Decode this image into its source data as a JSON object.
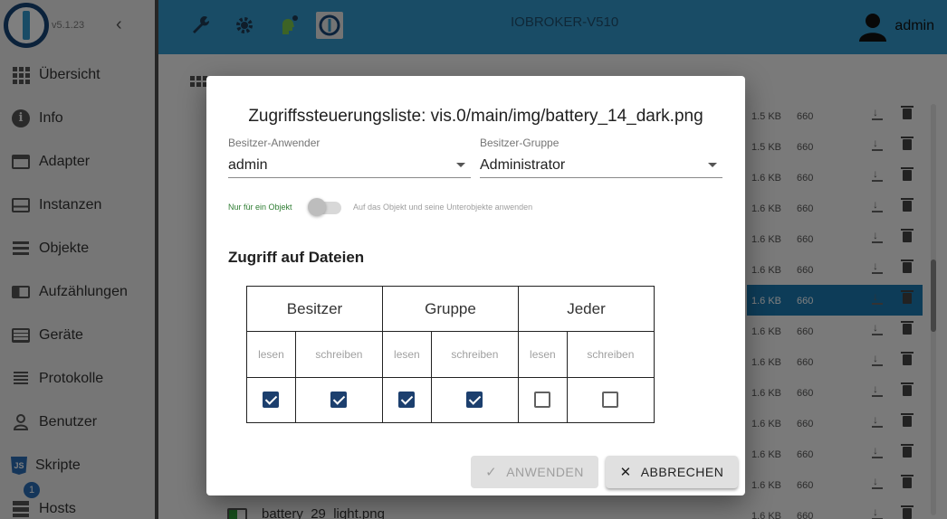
{
  "app": {
    "version": "v5.1.23",
    "host_title": "IOBROKER-V510",
    "user": "admin"
  },
  "sidebar": {
    "items": [
      {
        "label": "Übersicht",
        "icon": "grid-icon"
      },
      {
        "label": "Info",
        "icon": "info-icon"
      },
      {
        "label": "Adapter",
        "icon": "store-icon"
      },
      {
        "label": "Instanzen",
        "icon": "instances-icon"
      },
      {
        "label": "Objekte",
        "icon": "list-icon"
      },
      {
        "label": "Aufzählungen",
        "icon": "enum-icon"
      },
      {
        "label": "Geräte",
        "icon": "devices-icon"
      },
      {
        "label": "Protokolle",
        "icon": "log-icon"
      },
      {
        "label": "Benutzer",
        "icon": "user-icon"
      },
      {
        "label": "Skripte",
        "icon": "js-icon"
      },
      {
        "label": "Hosts",
        "icon": "hosts-icon",
        "badge": "1"
      }
    ]
  },
  "files": {
    "rows": [
      {
        "size": "1.5 KB",
        "perm": "660"
      },
      {
        "size": "1.5 KB",
        "perm": "660"
      },
      {
        "size": "1.6 KB",
        "perm": "660"
      },
      {
        "size": "1.6 KB",
        "perm": "660"
      },
      {
        "size": "1.6 KB",
        "perm": "660"
      },
      {
        "size": "1.6 KB",
        "perm": "660"
      },
      {
        "size": "1.6 KB",
        "perm": "660",
        "selected": true
      },
      {
        "size": "1.6 KB",
        "perm": "660"
      },
      {
        "size": "1.6 KB",
        "perm": "660"
      },
      {
        "size": "1.6 KB",
        "perm": "660"
      },
      {
        "size": "1.6 KB",
        "perm": "660"
      },
      {
        "size": "1.6 KB",
        "perm": "660"
      },
      {
        "size": "1.6 KB",
        "perm": "660"
      },
      {
        "size": "1.6 KB",
        "perm": "660"
      }
    ],
    "last_filename": "battery_29_light.png"
  },
  "dialog": {
    "title": "Zugriffssteuerungsliste: vis.0/main/img/battery_14_dark.png",
    "owner_user_label": "Besitzer-Anwender",
    "owner_user_value": "admin",
    "owner_group_label": "Besitzer-Gruppe",
    "owner_group_value": "Administrator",
    "switch_left_label": "Nur für ein Objekt",
    "switch_right_label": "Auf das Objekt und seine Unterobjekte anwenden",
    "switch_on": false,
    "section_title": "Zugriff auf Dateien",
    "groups": [
      "Besitzer",
      "Gruppe",
      "Jeder"
    ],
    "read_label": "lesen",
    "write_label": "schreiben",
    "permissions": [
      true,
      true,
      true,
      true,
      false,
      false
    ],
    "apply_label": "ANWENDEN",
    "cancel_label": "ABBRECHEN"
  },
  "colors": {
    "topbar": "#3399cc",
    "primary_dark": "#1c3f6e",
    "selected_row": "#1b78b0"
  }
}
